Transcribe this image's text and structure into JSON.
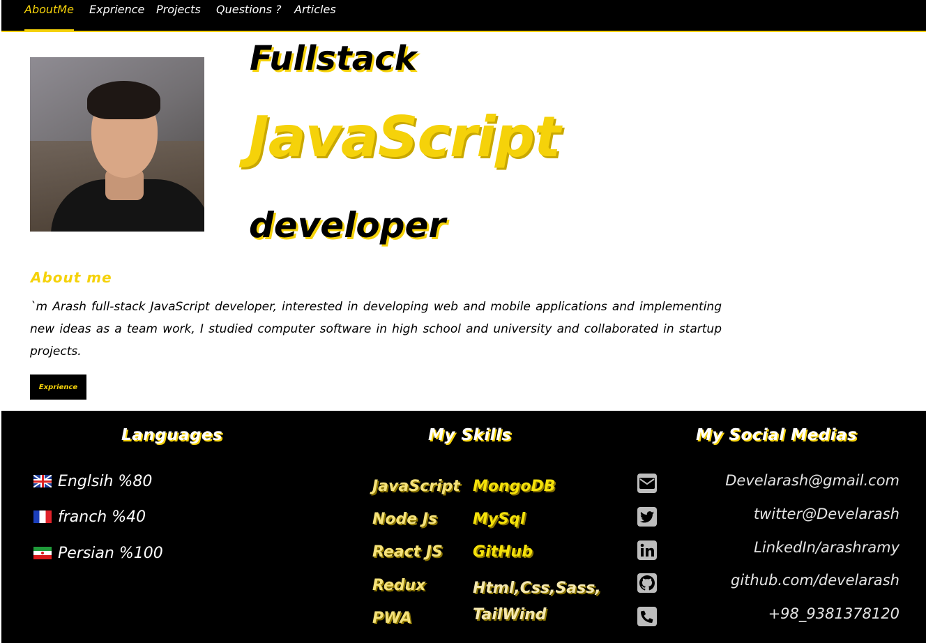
{
  "nav": {
    "items": [
      {
        "label": "AboutMe",
        "active": true
      },
      {
        "label": "Exprience",
        "active": false
      },
      {
        "label": "Projects",
        "active": false
      },
      {
        "label": "Questions ?",
        "active": false
      },
      {
        "label": "Articles",
        "active": false
      }
    ]
  },
  "hero": {
    "line1": "Fullstack",
    "line2": "JavaScript",
    "line3": "developer"
  },
  "about": {
    "title": "About me",
    "text": "`m Arash full-stack JavaScript developer, interested in developing web and mobile applications and implementing new ideas as a team work, I studied computer software in high school and university and collaborated in startup projects.",
    "button_label": "Exprience"
  },
  "footer": {
    "languages": {
      "title": "Languages",
      "items": [
        {
          "flag": "uk-flag-icon",
          "label": "Englsih %80"
        },
        {
          "flag": "france-flag-icon",
          "label": "franch %40"
        },
        {
          "flag": "iran-flag-icon",
          "label": "Persian %100"
        }
      ]
    },
    "skills": {
      "title": "My Skills",
      "col1": [
        "JavaScript",
        "Node Js",
        "React JS",
        "Redux",
        "PWA"
      ],
      "col2": [
        "MongoDB",
        "MySql",
        "GitHub",
        "Html,Css,Sass, TailWind"
      ]
    },
    "social": {
      "title": "My Social Medias",
      "items": [
        {
          "icon": "envelope-icon",
          "label": "Develarash@gmail.com"
        },
        {
          "icon": "twitter-icon",
          "label": "twitter@Develarash"
        },
        {
          "icon": "linkedin-icon",
          "label": "LinkedIn/arashramy"
        },
        {
          "icon": "github-icon",
          "label": "github.com/develarash"
        },
        {
          "icon": "phone-icon",
          "label": "+98_9381378120"
        }
      ]
    }
  },
  "colors": {
    "accent": "#f5d20a",
    "background": "#ffffff",
    "dark": "#000000"
  }
}
